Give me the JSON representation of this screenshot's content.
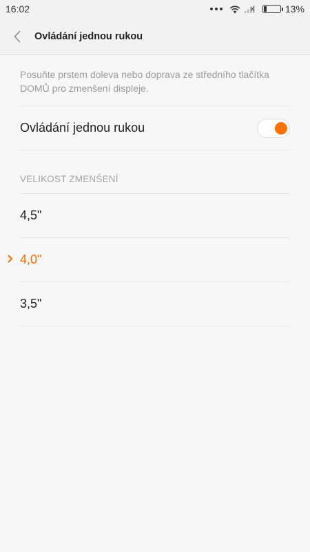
{
  "status_bar": {
    "time": "16:02",
    "battery": "13%"
  },
  "header": {
    "title": "Ovládání jednou rukou"
  },
  "description": "Posuňte prstem doleva nebo doprava ze středního tlačítka DOMŮ pro zmenšení displeje.",
  "toggle": {
    "label": "Ovládání jednou rukou",
    "enabled": true
  },
  "section": {
    "title": "VELIKOST ZMENŠENÍ"
  },
  "options": [
    {
      "label": "4,5\"",
      "selected": false
    },
    {
      "label": "4,0\"",
      "selected": true
    },
    {
      "label": "3,5\"",
      "selected": false
    }
  ],
  "colors": {
    "accent": "#ff7200"
  }
}
